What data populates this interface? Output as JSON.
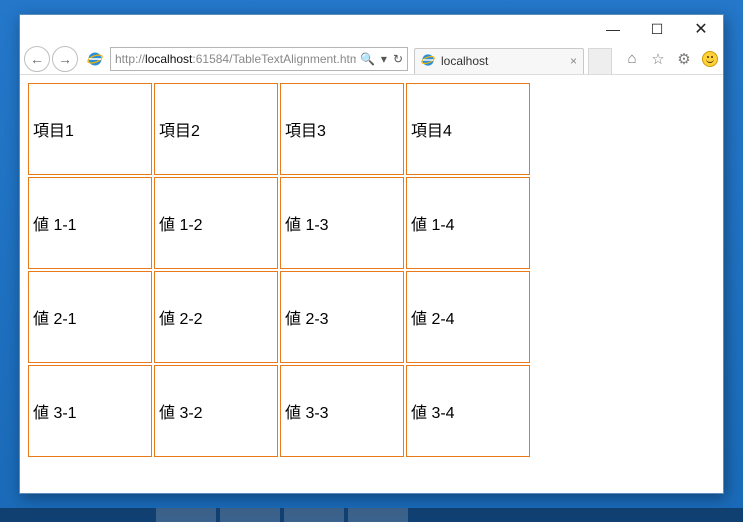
{
  "titlebar": {
    "minimize": "—",
    "maximize": "☐",
    "close": "✕"
  },
  "toolbar": {
    "back": "←",
    "forward": "→",
    "url_prefix": "http://",
    "url_host": "localhost",
    "url_port_path": ":61584/TableTextAlignment.htm",
    "search_hint": "🔍",
    "dropdown": "▾",
    "refresh": "↻",
    "tab_title": "localhost",
    "tab_close": "×",
    "home": "⌂",
    "favorites": "☆",
    "settings": "⚙",
    "feedback": "☺"
  },
  "table": {
    "rows": [
      [
        "項目1",
        "項目2",
        "項目3",
        "項目4"
      ],
      [
        "値 1-1",
        "値 1-2",
        "値 1-3",
        "値 1-4"
      ],
      [
        "値 2-1",
        "値 2-2",
        "値 2-3",
        "値 2-4"
      ],
      [
        "値 3-1",
        "値 3-2",
        "値 3-3",
        "値 3-4"
      ]
    ]
  }
}
